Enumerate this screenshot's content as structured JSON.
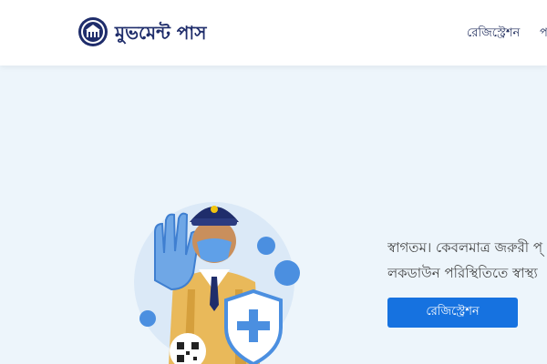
{
  "header": {
    "site_title": "মুভমেন্ট পাস",
    "nav": {
      "register": "রেজিস্ট্রেশন",
      "more": "প"
    }
  },
  "hero": {
    "welcome_line1": "স্বাগতম। কেবলমাত্র জরুরী প্",
    "welcome_line2": "লকডাউন পরিস্থিতিতে স্বাস্থ্য",
    "cta_label": "রেজিস্ট্রেশন"
  },
  "colors": {
    "page_background": "#edf5fb",
    "primary_button": "#1672e0",
    "brand_dark": "#1f2d6b"
  }
}
